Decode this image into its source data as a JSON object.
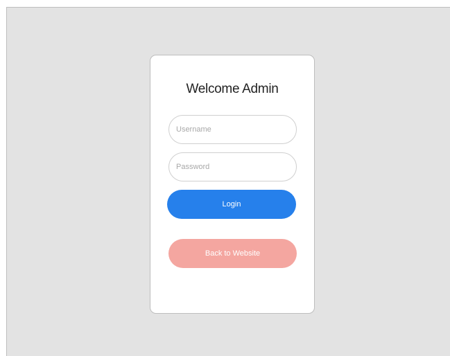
{
  "login_card": {
    "title": "Welcome Admin",
    "username_placeholder": "Username",
    "password_placeholder": "Password",
    "login_label": "Login",
    "back_label": "Back to Website"
  },
  "colors": {
    "page_background": "#e3e3e3",
    "card_background": "#ffffff",
    "login_button": "#2680eb",
    "back_button": "#f4a6a0"
  }
}
